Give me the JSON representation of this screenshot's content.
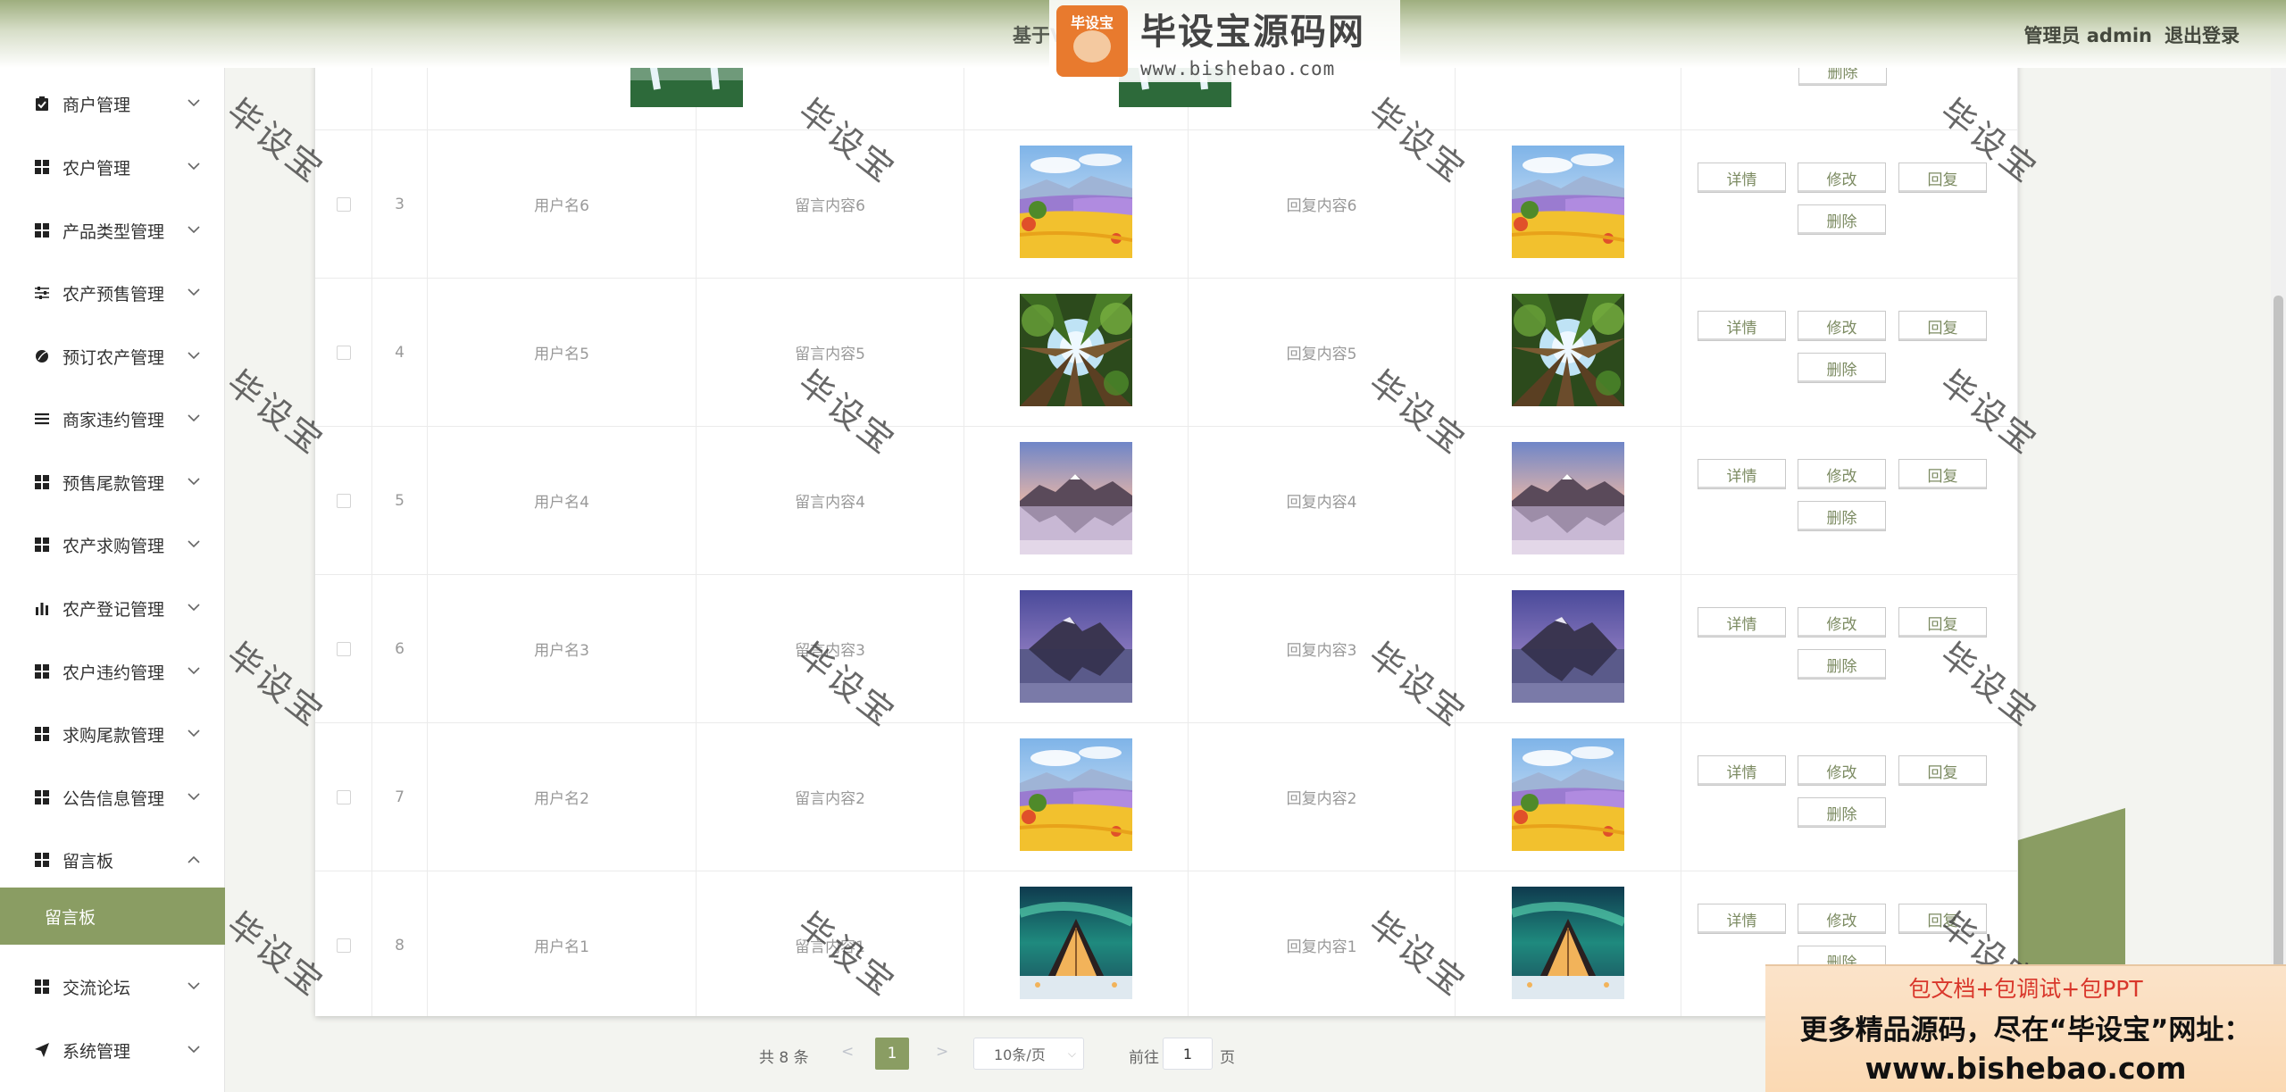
{
  "header": {
    "title": "基于VUE",
    "admin_label": "管理员 admin",
    "logout_label": "退出登录"
  },
  "logo": {
    "text": "毕设宝源码网",
    "url": "www.bishebao.com",
    "badge": "毕设宝"
  },
  "sidebar": {
    "items": [
      {
        "label": "商户管理",
        "icon": "clipboard-icon"
      },
      {
        "label": "农户管理",
        "icon": "grid-icon"
      },
      {
        "label": "产品类型管理",
        "icon": "grid-icon"
      },
      {
        "label": "农产预售管理",
        "icon": "sliders-icon"
      },
      {
        "label": "预订农产管理",
        "icon": "leaf-icon"
      },
      {
        "label": "商家违约管理",
        "icon": "list-icon"
      },
      {
        "label": "预售尾款管理",
        "icon": "grid-icon"
      },
      {
        "label": "农产求购管理",
        "icon": "grid-icon"
      },
      {
        "label": "农产登记管理",
        "icon": "bar-chart-icon"
      },
      {
        "label": "农户违约管理",
        "icon": "grid-icon"
      },
      {
        "label": "求购尾款管理",
        "icon": "grid-icon"
      },
      {
        "label": "公告信息管理",
        "icon": "grid-icon"
      },
      {
        "label": "留言板",
        "icon": "grid-icon",
        "expanded": true
      },
      {
        "label": "交流论坛",
        "icon": "grid-icon"
      },
      {
        "label": "系统管理",
        "icon": "send-icon"
      }
    ],
    "active_sub": "留言板"
  },
  "table": {
    "buttons": {
      "detail": "详情",
      "edit": "修改",
      "reply": "回复",
      "delete": "删除"
    },
    "rows": [
      {
        "index": "3",
        "username": "用户名6",
        "message": "留言内容6",
        "reply": "回复内容6",
        "image": "lavender-field"
      },
      {
        "index": "4",
        "username": "用户名5",
        "message": "留言内容5",
        "reply": "回复内容5",
        "image": "forest-canopy"
      },
      {
        "index": "5",
        "username": "用户名4",
        "message": "留言内容4",
        "reply": "回复内容4",
        "image": "mountain-lake"
      },
      {
        "index": "6",
        "username": "用户名3",
        "message": "留言内容3",
        "reply": "回复内容3",
        "image": "purple-mountain"
      },
      {
        "index": "7",
        "username": "用户名2",
        "message": "留言内容2",
        "reply": "回复内容2",
        "image": "lavender-field"
      },
      {
        "index": "8",
        "username": "用户名1",
        "message": "留言内容1",
        "reply": "回复内容1",
        "image": "aurora-cabin"
      }
    ]
  },
  "pagination": {
    "total": "共 8 条",
    "prev": "<",
    "current": "1",
    "next": ">",
    "page_size": "10条/页",
    "goto_label": "前往",
    "goto_value": "1",
    "goto_unit": "页"
  },
  "watermark": "毕设宝",
  "ad": {
    "line1": "包文档+包调试+包PPT",
    "line2": "更多精品源码，尽在“毕设宝”网址：",
    "line3": "www.bishebao.com"
  },
  "colors": {
    "accent": "#8a9d63",
    "header_start": "#9eae7e"
  }
}
